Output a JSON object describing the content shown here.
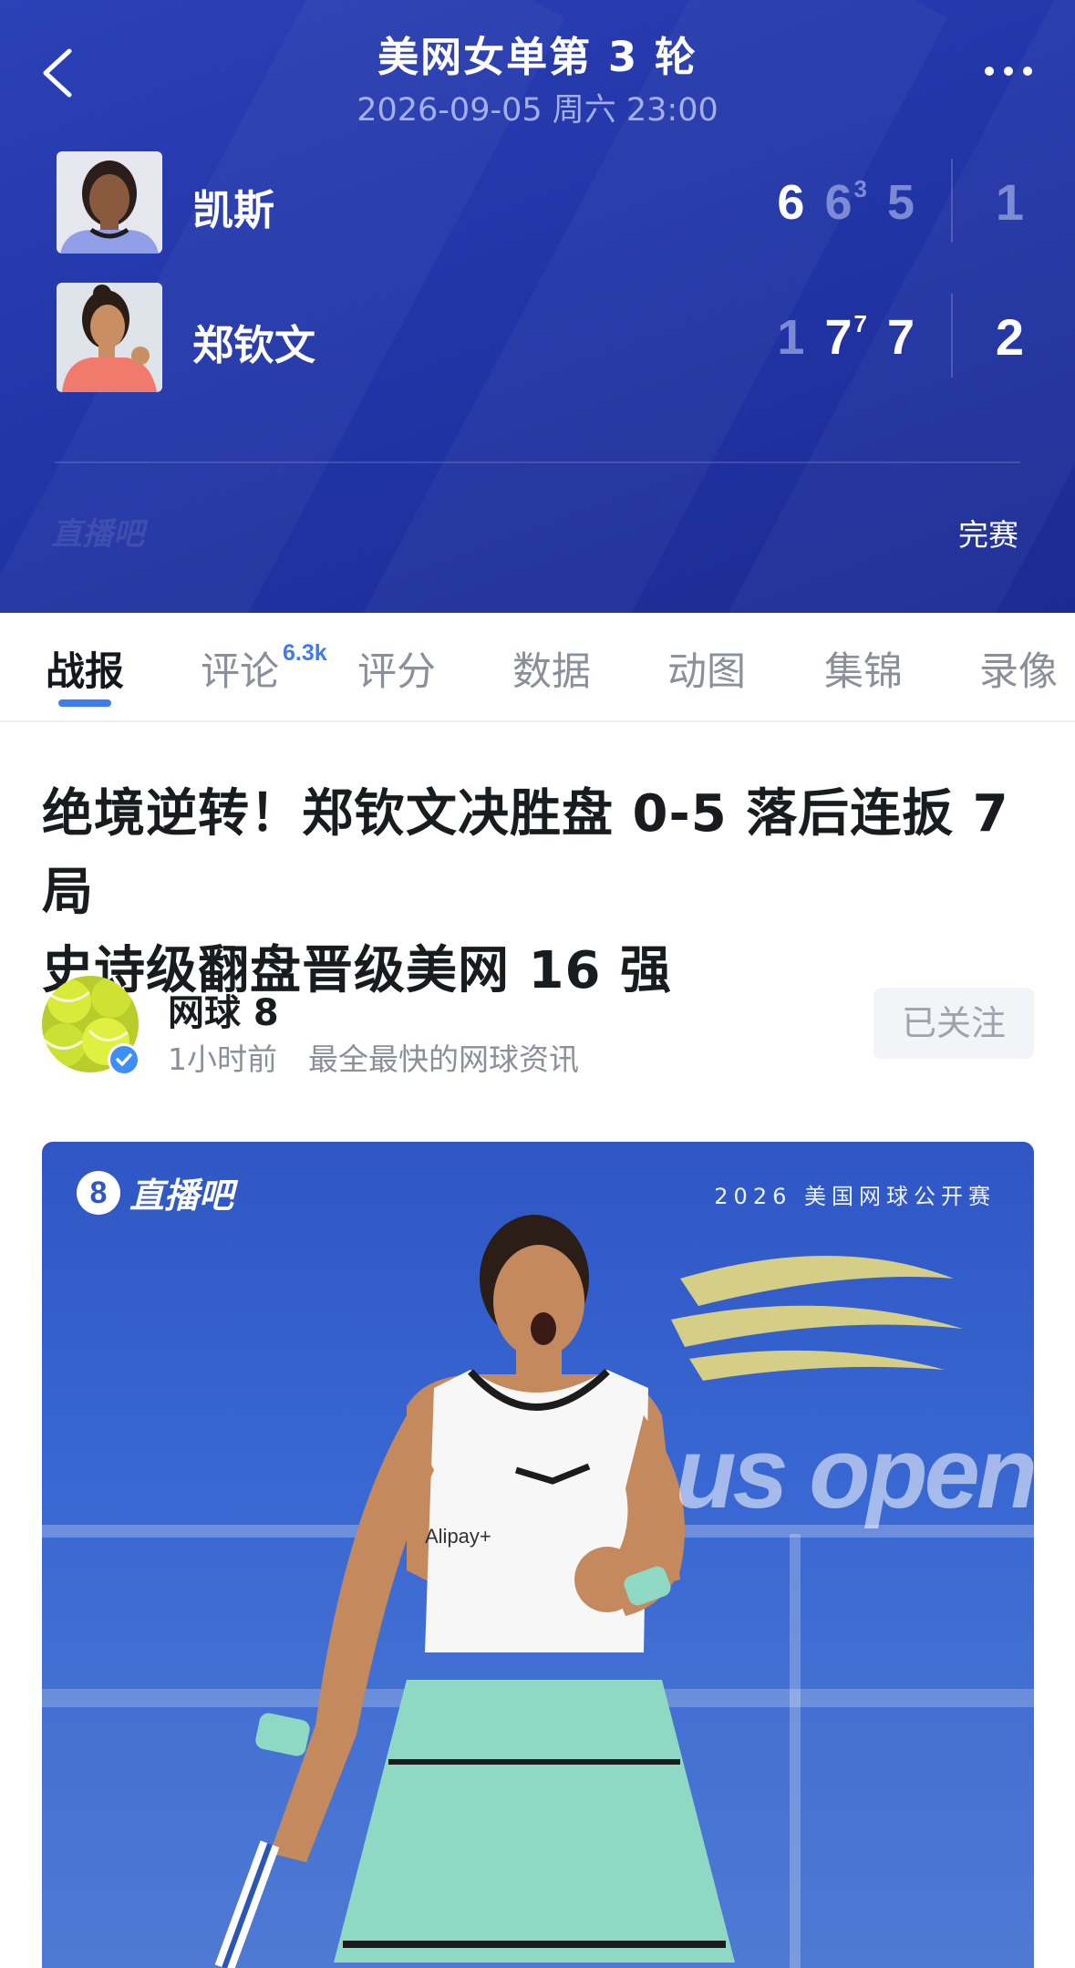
{
  "header": {
    "title": "美网女单第 3 轮",
    "datetime": "2026-09-05 周六 23:00",
    "status": "完赛",
    "faint_logo": "直播吧"
  },
  "players": [
    {
      "name": "凯斯",
      "sets": [
        {
          "games": "6",
          "tb": ""
        },
        {
          "games": "6",
          "tb": "3"
        },
        {
          "games": "5",
          "tb": ""
        }
      ],
      "sets_won": "1"
    },
    {
      "name": "郑钦文",
      "sets": [
        {
          "games": "1",
          "tb": ""
        },
        {
          "games": "7",
          "tb": "7"
        },
        {
          "games": "7",
          "tb": ""
        }
      ],
      "sets_won": "2"
    }
  ],
  "tabs": [
    {
      "label": "战报",
      "active": true
    },
    {
      "label": "评论",
      "badge": "6.3k"
    },
    {
      "label": "评分"
    },
    {
      "label": "数据"
    },
    {
      "label": "动图"
    },
    {
      "label": "集锦"
    },
    {
      "label": "录像"
    }
  ],
  "article": {
    "headline_line1": "绝境逆转！郑钦文决胜盘 0-5 落后连扳 7 局",
    "headline_line2": "史诗级翻盘晋级美网 16 强",
    "author": {
      "name": "网球 8",
      "time": "1小时前",
      "bio": "最全最快的网球资讯",
      "follow_label": "已关注"
    },
    "hero": {
      "brand_mark": "8",
      "brand": "直播吧",
      "event": "2026 美国网球公开赛",
      "sign": "us open",
      "shirt_text": "Alipay+"
    }
  },
  "colors": {
    "header_bg": "#2236a8",
    "accent": "#3e7bef",
    "text_primary": "#1a1b1f",
    "text_secondary": "#8a8f99"
  }
}
